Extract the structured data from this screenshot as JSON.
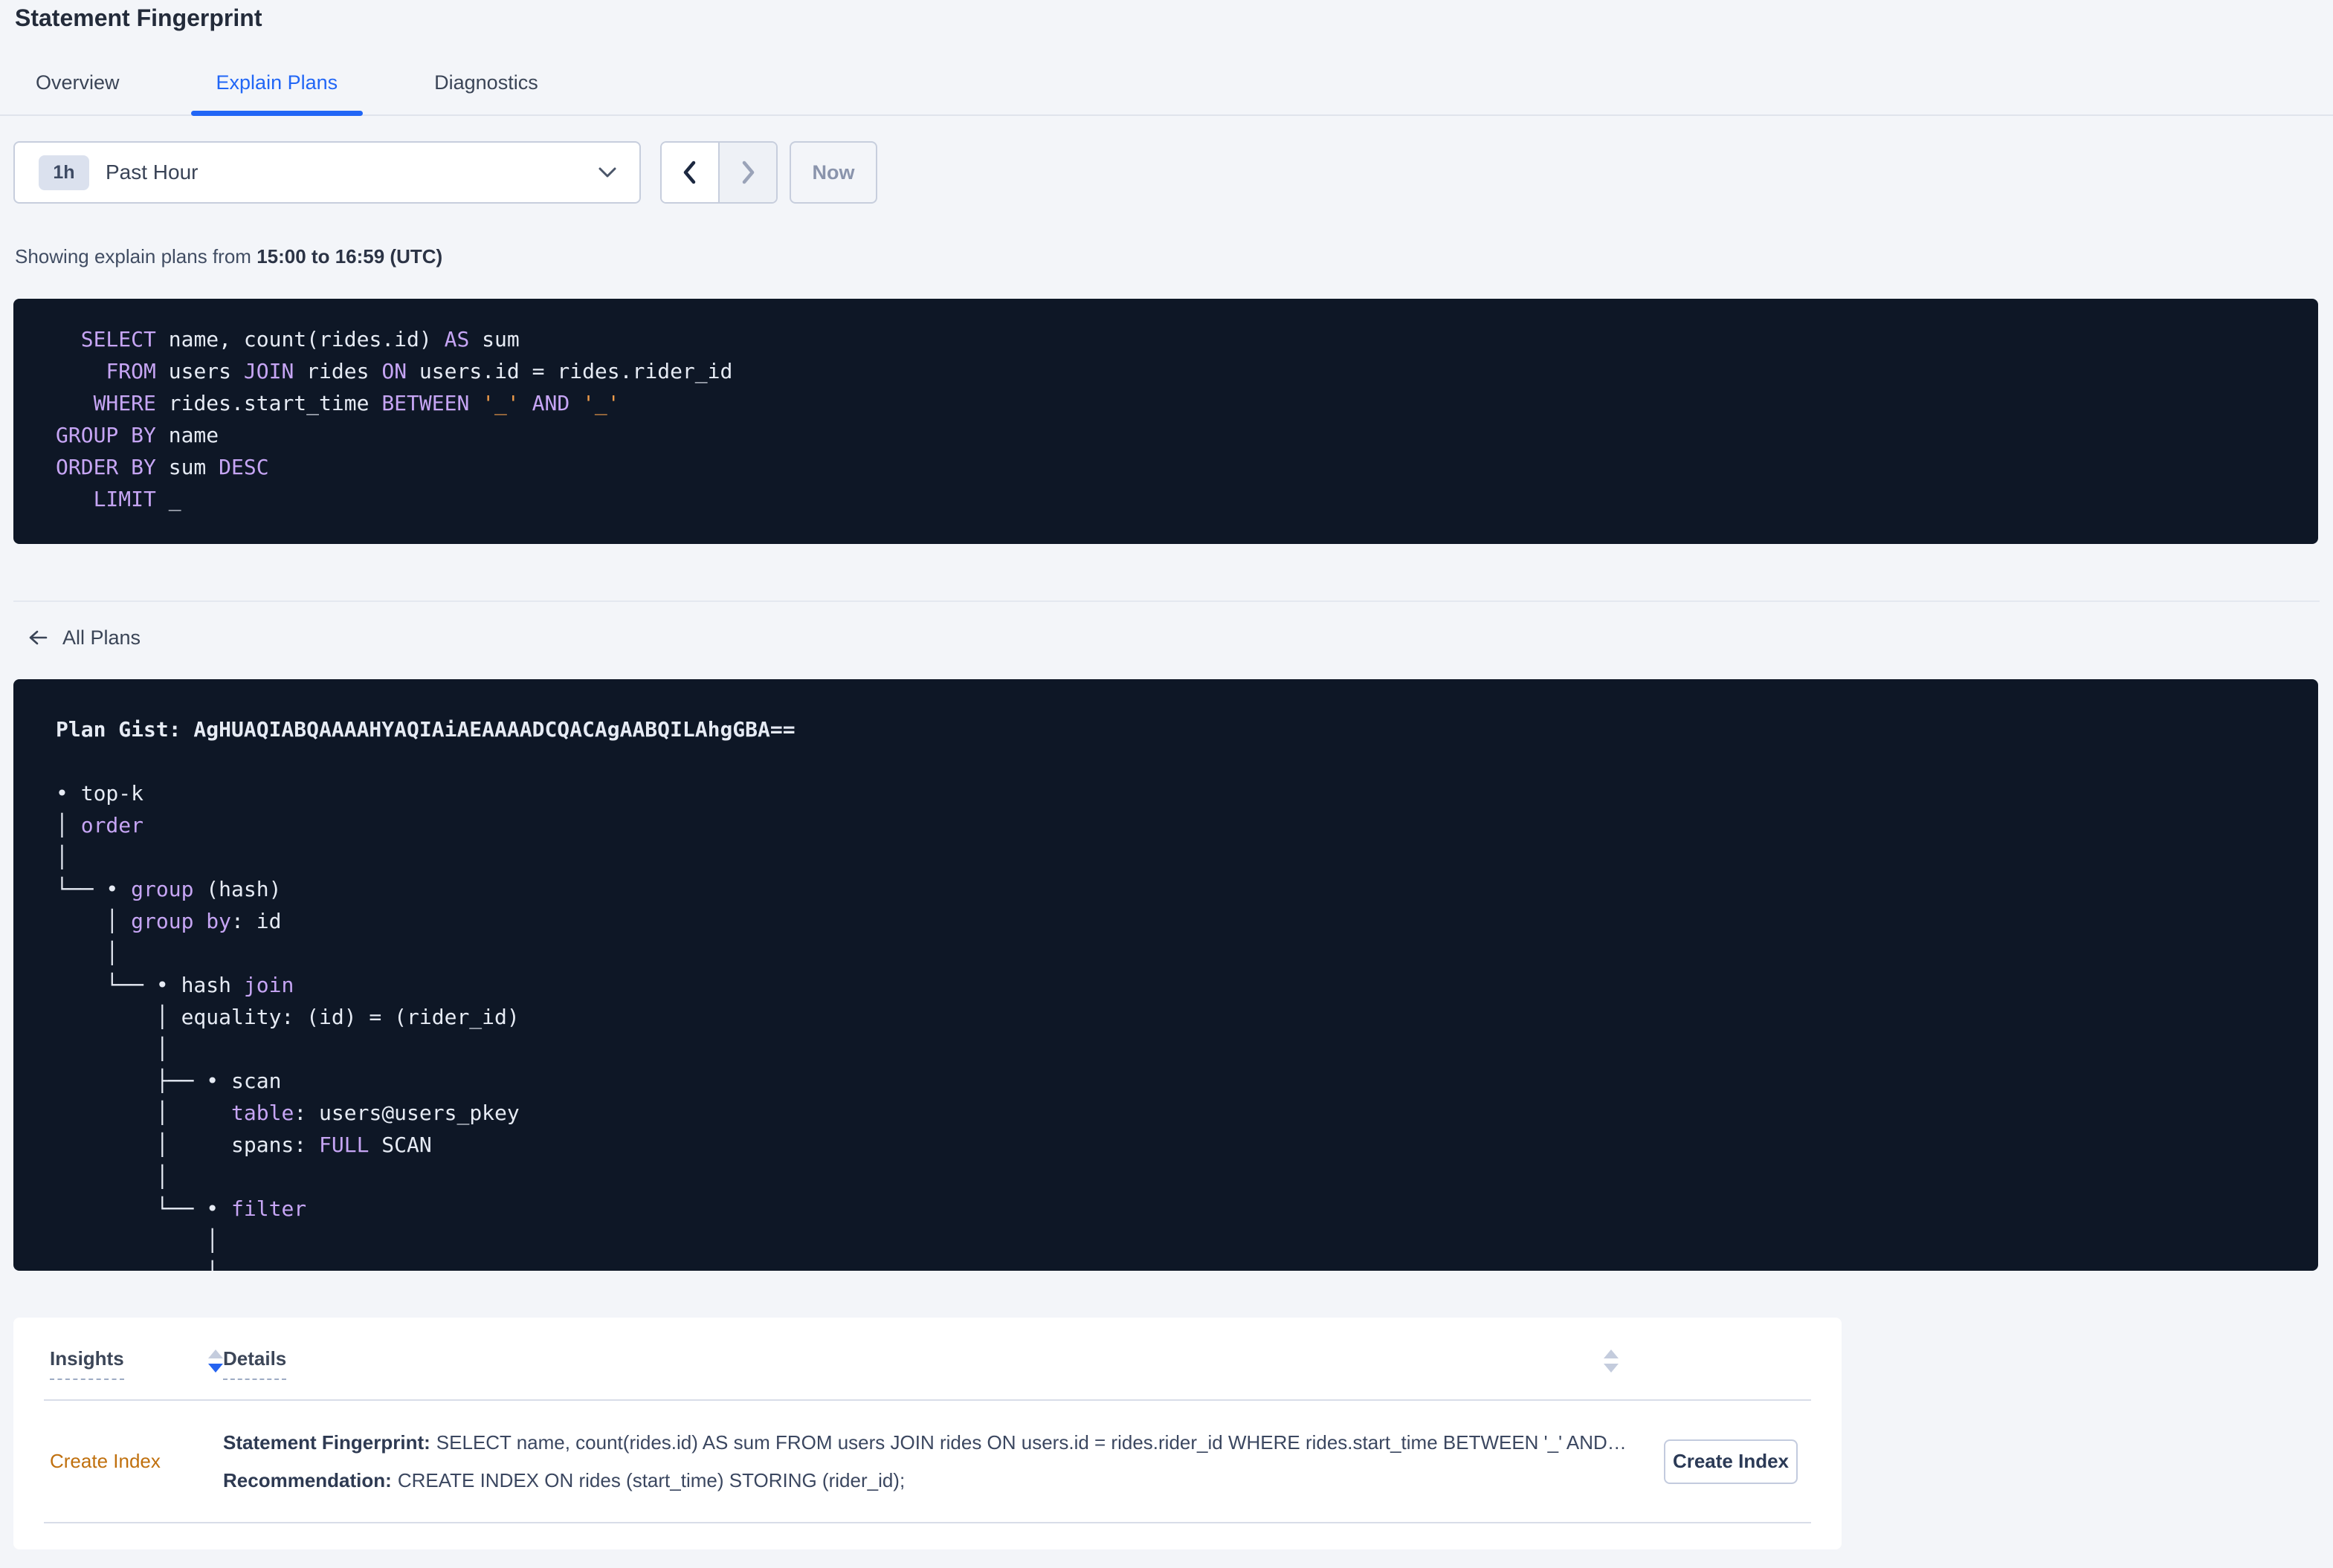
{
  "header": {
    "title": "Statement Fingerprint"
  },
  "tabs": [
    {
      "label": "Overview",
      "active": false
    },
    {
      "label": "Explain Plans",
      "active": true
    },
    {
      "label": "Diagnostics",
      "active": false
    }
  ],
  "time_controls": {
    "interval_badge": "1h",
    "interval_label": "Past Hour",
    "now_label": "Now"
  },
  "summary": {
    "prefix": "Showing explain plans from",
    "range": "15:00 to 16:59 (UTC)"
  },
  "sql": {
    "lines": [
      [
        {
          "t": "  ",
          "c": "pl"
        },
        {
          "t": "SELECT",
          "c": "kw"
        },
        {
          "t": " name, count(rides.id) ",
          "c": "pl"
        },
        {
          "t": "AS",
          "c": "kw"
        },
        {
          "t": " sum",
          "c": "pl"
        }
      ],
      [
        {
          "t": "    ",
          "c": "pl"
        },
        {
          "t": "FROM",
          "c": "kw"
        },
        {
          "t": " users ",
          "c": "pl"
        },
        {
          "t": "JOIN",
          "c": "kw"
        },
        {
          "t": " rides ",
          "c": "pl"
        },
        {
          "t": "ON",
          "c": "kw"
        },
        {
          "t": " users.id = rides.rider_id",
          "c": "pl"
        }
      ],
      [
        {
          "t": "   ",
          "c": "pl"
        },
        {
          "t": "WHERE",
          "c": "kw"
        },
        {
          "t": " rides.start_time ",
          "c": "pl"
        },
        {
          "t": "BETWEEN",
          "c": "kw"
        },
        {
          "t": " ",
          "c": "pl"
        },
        {
          "t": "'_'",
          "c": "lit"
        },
        {
          "t": " ",
          "c": "pl"
        },
        {
          "t": "AND",
          "c": "kw"
        },
        {
          "t": " ",
          "c": "pl"
        },
        {
          "t": "'_'",
          "c": "lit"
        }
      ],
      [
        {
          "t": "GROUP BY",
          "c": "kw"
        },
        {
          "t": " name",
          "c": "pl"
        }
      ],
      [
        {
          "t": "ORDER BY",
          "c": "kw"
        },
        {
          "t": " sum ",
          "c": "pl"
        },
        {
          "t": "DESC",
          "c": "kw"
        }
      ],
      [
        {
          "t": "   ",
          "c": "pl"
        },
        {
          "t": "LIMIT",
          "c": "kw"
        },
        {
          "t": " _",
          "c": "pl"
        }
      ]
    ]
  },
  "all_plans": {
    "label": "All Plans"
  },
  "plan": {
    "lines": [
      [
        {
          "t": "Plan Gist: AgHUAQIABQAAAAHYAQIAiAEAAAADCQACAgAABQILAhgGBA==",
          "c": "b"
        }
      ],
      [],
      [
        {
          "t": "• top-k",
          "c": "pl"
        }
      ],
      [
        {
          "t": "│ ",
          "c": "pl"
        },
        {
          "t": "order",
          "c": "kw"
        }
      ],
      [
        {
          "t": "│",
          "c": "pl"
        }
      ],
      [
        {
          "t": "└── • ",
          "c": "pl"
        },
        {
          "t": "group",
          "c": "kw"
        },
        {
          "t": " (hash)",
          "c": "pl"
        }
      ],
      [
        {
          "t": "    │ ",
          "c": "pl"
        },
        {
          "t": "group by",
          "c": "kw"
        },
        {
          "t": ": id",
          "c": "pl"
        }
      ],
      [
        {
          "t": "    │",
          "c": "pl"
        }
      ],
      [
        {
          "t": "    └── • hash ",
          "c": "pl"
        },
        {
          "t": "join",
          "c": "kw"
        }
      ],
      [
        {
          "t": "        │ equality: (id) = (rider_id)",
          "c": "pl"
        }
      ],
      [
        {
          "t": "        │",
          "c": "pl"
        }
      ],
      [
        {
          "t": "        ├── • scan",
          "c": "pl"
        }
      ],
      [
        {
          "t": "        │     ",
          "c": "pl"
        },
        {
          "t": "table",
          "c": "kw"
        },
        {
          "t": ": users@users_pkey",
          "c": "pl"
        }
      ],
      [
        {
          "t": "        │     spans: ",
          "c": "pl"
        },
        {
          "t": "FULL",
          "c": "kw"
        },
        {
          "t": " SCAN",
          "c": "pl"
        }
      ],
      [
        {
          "t": "        │",
          "c": "pl"
        }
      ],
      [
        {
          "t": "        └── • ",
          "c": "pl"
        },
        {
          "t": "filter",
          "c": "kw"
        }
      ],
      [
        {
          "t": "            │",
          "c": "pl"
        }
      ],
      [
        {
          "t": "            │",
          "c": "pl"
        }
      ]
    ]
  },
  "insights": {
    "columns": [
      {
        "label": "Insights",
        "sort": "desc"
      },
      {
        "label": "Details",
        "sort": "none"
      }
    ],
    "row": {
      "insight": "Create Index",
      "fingerprint_label": "Statement Fingerprint:",
      "fingerprint": "SELECT name, count(rides.id) AS sum FROM users JOIN rides ON users.id = rides.rider_id WHERE rides.start_time BETWEEN '_' AND '_' GROUP BY name ORDER BY sum DESC LIMIT _",
      "recommendation_label": "Recommendation:",
      "recommendation": "CREATE INDEX ON rides (start_time) STORING (rider_id);",
      "action": "Create Index"
    }
  },
  "colors": {
    "accent_blue": "#2166f6",
    "code_bg": "#0e1726",
    "code_keyword": "#c6a5f4",
    "code_literal": "#ed9b4a",
    "code_plain": "#e6ebf4",
    "insight_link": "#c0700e"
  }
}
